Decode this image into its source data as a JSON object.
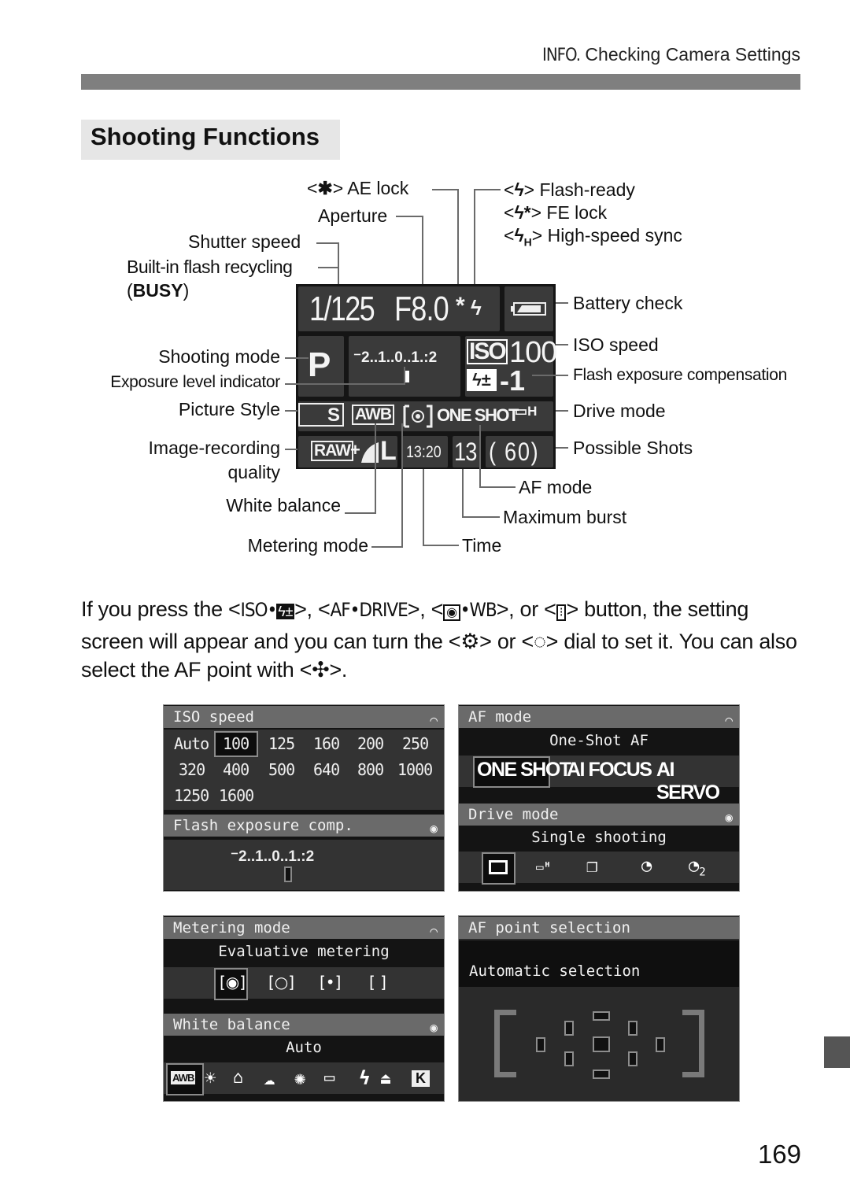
{
  "header": {
    "section_icon": "INFO.",
    "section_title": "Checking Camera Settings"
  },
  "page_title": "Shooting Functions",
  "callouts_top_left": {
    "ae_lock": "AE lock",
    "ae_lock_symbol": "✱",
    "aperture": "Aperture",
    "shutter_speed": "Shutter speed",
    "flash_recycling": "Built-in flash recycling",
    "busy_prefix": "(",
    "busy": "BUSY",
    "busy_suffix": ")"
  },
  "callouts_top_right": {
    "flash_ready": "Flash-ready",
    "fe_lock": "FE lock",
    "high_speed_sync": "High-speed sync"
  },
  "callouts_left": {
    "shooting_mode": "Shooting mode",
    "exposure_level": "Exposure level indicator",
    "picture_style": "Picture Style",
    "image_quality_1": "Image-recording",
    "image_quality_2": "quality",
    "white_balance": "White balance",
    "metering_mode": "Metering mode"
  },
  "callouts_right": {
    "battery_check": "Battery check",
    "iso_speed": "ISO speed",
    "flash_exp_comp": "Flash exposure compensation",
    "drive_mode": "Drive mode",
    "possible_shots": "Possible Shots"
  },
  "callouts_bottom": {
    "af_mode": "AF mode",
    "max_burst": "Maximum burst",
    "time": "Time"
  },
  "lcd": {
    "shutter": "1/125",
    "aperture": "F8.0",
    "ae_lock_glyph": "*",
    "flash_glyph": "ϟ",
    "mode": "P",
    "exposure_scale": "⁻2..1..0..1.:2",
    "iso_label": "ISO",
    "iso_value": "100",
    "flash_comp": "-1",
    "picture_style": "S",
    "wb": "AWB",
    "af_mode": "ONE SHOT",
    "drive": "H",
    "quality_raw": "RAW",
    "quality_plus": "+",
    "quality_size": "L",
    "time": "13:20",
    "max_burst": "13",
    "shots": "( 60)"
  },
  "body": {
    "part1": "If you press the <",
    "iso_btn": "ISO•",
    "part2": ">, <",
    "af_btn": "AF•DRIVE",
    "part3": ">, <",
    "wb_btn": "•WB",
    "part4": ">, or <",
    "part5": "> button, the setting screen will appear and you can turn the <",
    "part6": "> or <",
    "part7": "> dial to set it. You can also select the AF point with <",
    "part8": ">."
  },
  "screens": {
    "iso": {
      "title": "ISO speed",
      "selected": "100",
      "values": [
        "Auto",
        "100",
        "125",
        "160",
        "200",
        "250",
        "320",
        "400",
        "500",
        "640",
        "800",
        "1000",
        "1250",
        "1600"
      ]
    },
    "fec": {
      "title": "Flash exposure comp.",
      "scale": "⁻2..1..0..1.:2"
    },
    "af": {
      "title": "AF mode",
      "current": "One-Shot AF",
      "options": [
        "ONE SHOT",
        "AI FOCUS",
        "AI SERVO"
      ],
      "selected": "ONE SHOT"
    },
    "drive": {
      "title": "Drive mode",
      "current": "Single shooting",
      "options": [
        "single-shooting",
        "high-speed-continuous",
        "low-speed-continuous",
        "self-timer-10s",
        "self-timer-2s"
      ],
      "selected": "single-shooting"
    },
    "metering": {
      "title": "Metering mode",
      "current": "Evaluative metering",
      "options": [
        "evaluative",
        "partial",
        "spot",
        "center-weighted"
      ],
      "selected": "evaluative"
    },
    "wb": {
      "title": "White balance",
      "current": "Auto",
      "options": [
        "AWB",
        "daylight",
        "shade",
        "cloudy",
        "tungsten",
        "fluorescent",
        "flash",
        "custom",
        "K"
      ],
      "selected": "AWB"
    },
    "afpoint": {
      "title": "AF point selection",
      "current": "Automatic selection"
    }
  },
  "page_number": "169"
}
